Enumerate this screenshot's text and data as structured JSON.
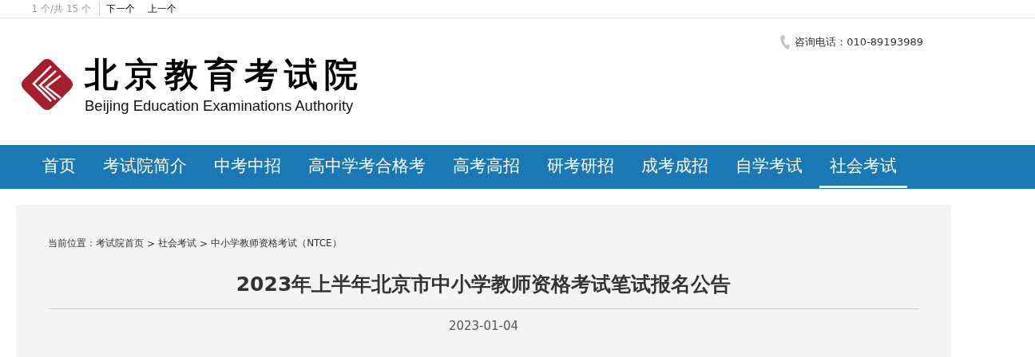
{
  "find_bar": {
    "value": "1 个/共 15 个",
    "links": [
      "下一个",
      "上一个"
    ]
  },
  "header": {
    "title_cn": "北京教育考试院",
    "title_en": "Beijing Education Examinations Authority",
    "phone": "咨询电话：010-89193989"
  },
  "nav": [
    {
      "label": "首页",
      "selected": false
    },
    {
      "label": "考试院简介",
      "selected": false
    },
    {
      "label": "中考中招",
      "selected": false
    },
    {
      "label": "高中学考合格考",
      "selected": false
    },
    {
      "label": "高考高招",
      "selected": false
    },
    {
      "label": "研考研招",
      "selected": false
    },
    {
      "label": "成考成招",
      "selected": false
    },
    {
      "label": "自学考试",
      "selected": false
    },
    {
      "label": "社会考试",
      "selected": true
    }
  ],
  "breadcrumb": {
    "label": "当前位置：",
    "items": [
      "考试院首页",
      "社会考试",
      "中小学教师资格考试（NTCE）"
    ],
    "separator": ">"
  },
  "article": {
    "title": "2023年上半年北京市中小学教师资格考试笔试报名公告",
    "date": "2023-01-04"
  }
}
